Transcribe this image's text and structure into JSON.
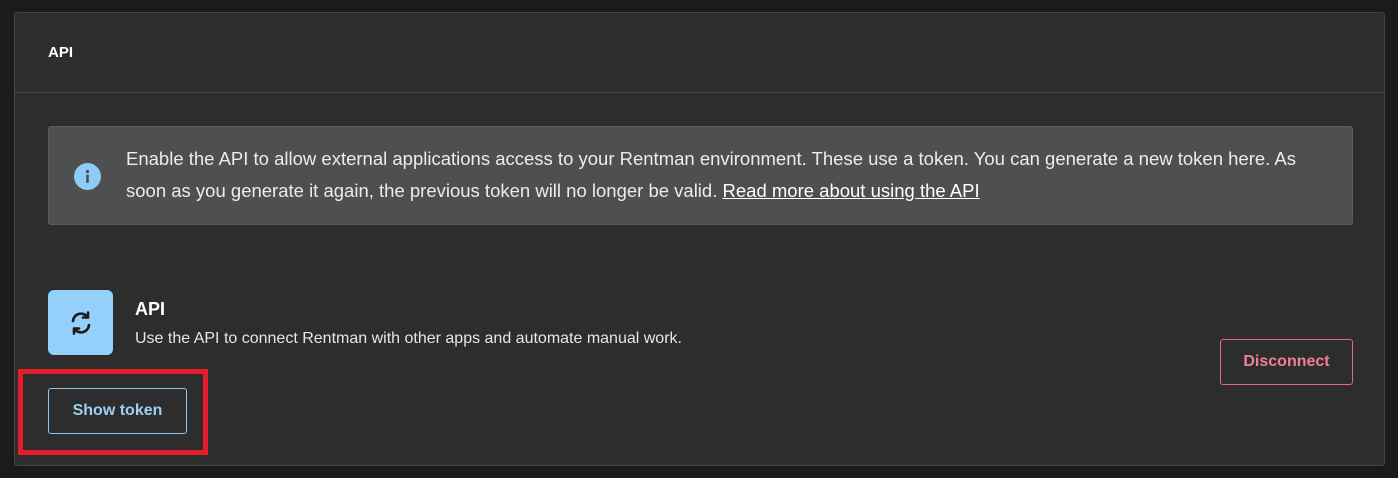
{
  "panel": {
    "title": "API"
  },
  "info": {
    "icon": "info-icon",
    "text": "Enable the API to allow external applications access to your Rentman environment. These use a token. You can generate a new token here. As soon as you generate it again, the previous token will no longer be valid. ",
    "link_label": "Read more about using the API"
  },
  "integration": {
    "icon": "sync-icon",
    "title": "API",
    "description": "Use the API to connect Rentman with other apps and automate manual work.",
    "disconnect_label": "Disconnect",
    "show_token_label": "Show token"
  },
  "colors": {
    "background": "#2d2d2d",
    "info_bg": "#4d4f51",
    "accent_blue": "#94d0fa",
    "danger": "#ef7f99",
    "highlight": "#e41e2a"
  }
}
